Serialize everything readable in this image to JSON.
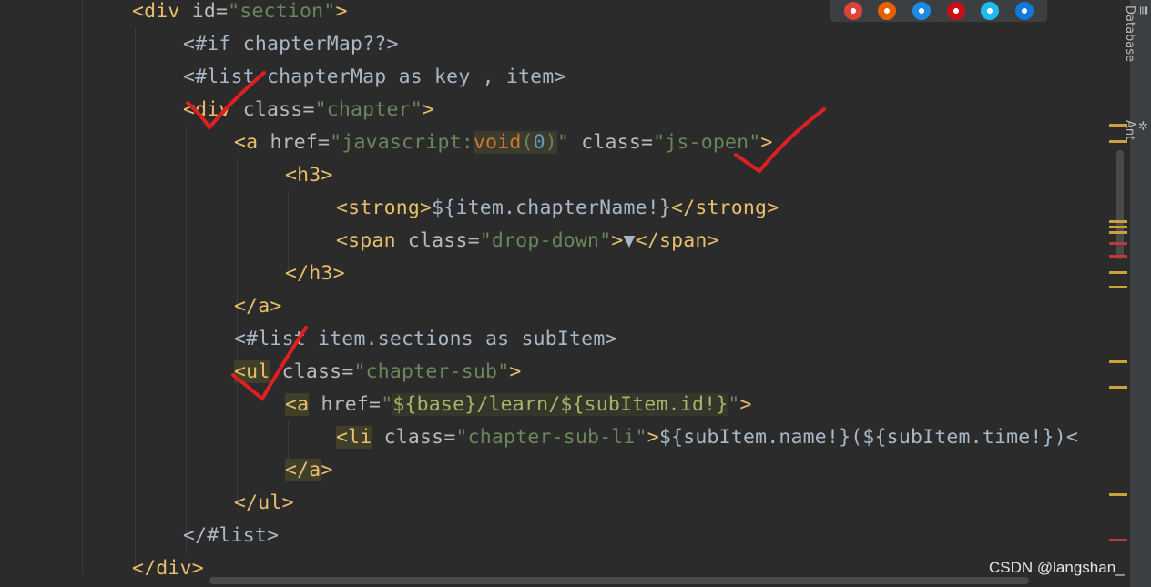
{
  "code_lines": [
    {
      "indent": 1,
      "parts": [
        [
          "tag",
          "<div "
        ],
        [
          "attr",
          "id="
        ],
        [
          "str",
          "\"section\""
        ],
        [
          "tag",
          ">"
        ]
      ]
    },
    {
      "indent": 2,
      "parts": [
        [
          "ftl",
          "<#if chapterMap??>"
        ]
      ]
    },
    {
      "indent": 2,
      "parts": [
        [
          "ftl",
          "<#list chapterMap as key , item>"
        ]
      ]
    },
    {
      "indent": 2,
      "parts": [
        [
          "tag",
          "<div "
        ],
        [
          "attr",
          "class="
        ],
        [
          "str",
          "\"chapter\""
        ],
        [
          "tag",
          ">"
        ]
      ]
    },
    {
      "indent": 3,
      "parts": [
        [
          "tag",
          "<a "
        ],
        [
          "attr",
          "href="
        ],
        [
          "str",
          "\"javascript:"
        ],
        [
          "kwhl",
          "void"
        ],
        [
          "strhl2",
          "("
        ],
        [
          "numhl",
          "0"
        ],
        [
          "strhl2",
          ")"
        ],
        [
          "str",
          "\" "
        ],
        [
          "attr",
          "class="
        ],
        [
          "str",
          "\"js-open\""
        ],
        [
          "tag",
          ">"
        ]
      ]
    },
    {
      "indent": 4,
      "parts": [
        [
          "tag",
          "<h3>"
        ]
      ]
    },
    {
      "indent": 5,
      "parts": [
        [
          "tag",
          "<strong>"
        ],
        [
          "ftl",
          "${item.chapterName!}"
        ],
        [
          "tag",
          "</strong>"
        ]
      ]
    },
    {
      "indent": 5,
      "parts": [
        [
          "tag",
          "<span "
        ],
        [
          "attr",
          "class="
        ],
        [
          "str",
          "\"drop-down\""
        ],
        [
          "tag",
          ">"
        ],
        [
          "ftl",
          "▼"
        ],
        [
          "tag",
          "</span>"
        ]
      ]
    },
    {
      "indent": 4,
      "parts": [
        [
          "tag",
          "</h3>"
        ]
      ]
    },
    {
      "indent": 3,
      "parts": [
        [
          "tag",
          "</a>"
        ]
      ]
    },
    {
      "indent": 3,
      "parts": [
        [
          "ftl",
          "<#list item.sections as subItem>"
        ]
      ]
    },
    {
      "indent": 3,
      "parts": [
        [
          "taghl",
          "<ul"
        ],
        [
          "tag",
          " "
        ],
        [
          "attr",
          "class="
        ],
        [
          "str",
          "\"chapter-sub\""
        ],
        [
          "tag",
          ">"
        ]
      ]
    },
    {
      "indent": 4,
      "parts": [
        [
          "taghl",
          "<a"
        ],
        [
          "tag",
          " "
        ],
        [
          "attr",
          "href="
        ],
        [
          "str",
          "\""
        ],
        [
          "strhl",
          "${base}/learn/${subItem.id!}"
        ],
        [
          "str",
          "\""
        ],
        [
          "tag",
          ">"
        ]
      ]
    },
    {
      "indent": 5,
      "parts": [
        [
          "taghl",
          "<li"
        ],
        [
          "tag",
          " "
        ],
        [
          "attr",
          "class="
        ],
        [
          "str",
          "\"chapter-sub-li\""
        ],
        [
          "tag",
          ">"
        ],
        [
          "ftl",
          "${subItem.name!}(${subItem.time!})<"
        ]
      ]
    },
    {
      "indent": 4,
      "parts": [
        [
          "taghl",
          "</a"
        ],
        [
          "tag",
          ">"
        ]
      ]
    },
    {
      "indent": 3,
      "parts": [
        [
          "tag",
          "</ul>"
        ]
      ]
    },
    {
      "indent": 2,
      "parts": [
        [
          "ftl",
          "</#list>"
        ]
      ]
    },
    {
      "indent": 1,
      "parts": [
        [
          "tag",
          "</div>"
        ]
      ]
    }
  ],
  "side_tabs": [
    {
      "label": "Database",
      "icon": "database-icon"
    },
    {
      "label": "Ant",
      "icon": "ant-icon"
    }
  ],
  "browser_icons": [
    "chrome-icon",
    "firefox-icon",
    "safari-icon",
    "opera-icon",
    "ie-icon",
    "edge-icon"
  ],
  "watermark": "CSDN @langshan_",
  "colors": {
    "tag": "#e8bf6a",
    "attr": "#bababa",
    "string": "#6a8759",
    "keyword": "#cc7832",
    "number": "#6897bb",
    "annotation": "#e02020"
  }
}
